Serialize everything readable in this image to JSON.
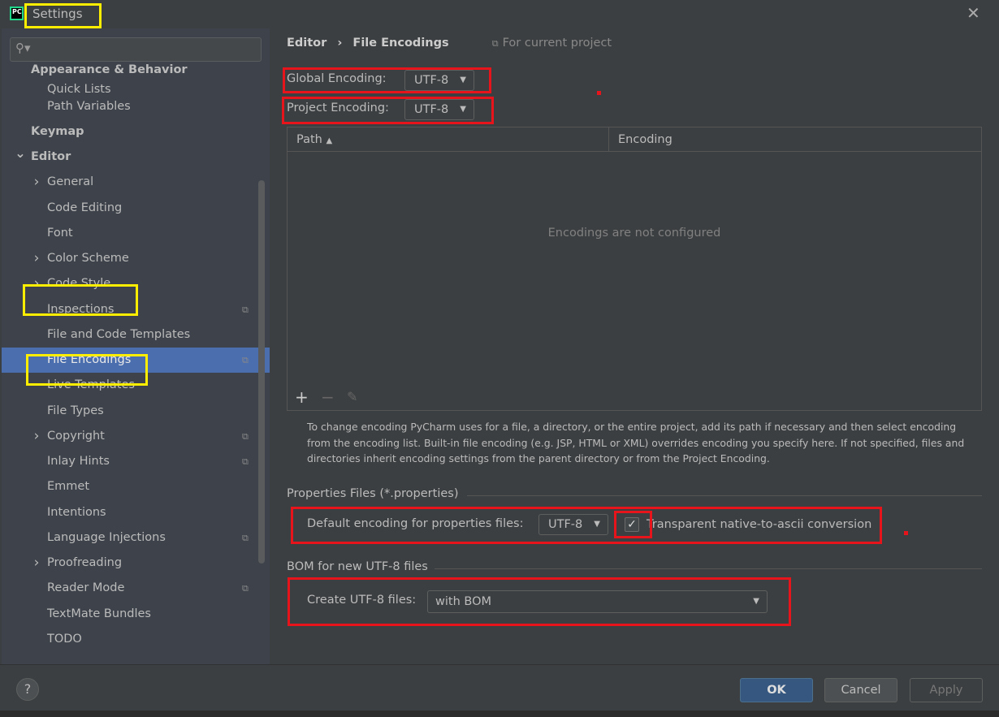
{
  "window": {
    "title": "Settings",
    "app_icon": "pycharm-icon"
  },
  "search": {
    "placeholder": ""
  },
  "sidebar": {
    "items": [
      {
        "label": "Appearance & Behavior",
        "bold": true
      },
      {
        "label": "Quick Lists"
      },
      {
        "label": "Path Variables"
      },
      {
        "label": "Keymap",
        "bold": true
      },
      {
        "label": "Editor",
        "bold": true,
        "expanded": true
      },
      {
        "label": "General",
        "chevron": true
      },
      {
        "label": "Code Editing"
      },
      {
        "label": "Font"
      },
      {
        "label": "Color Scheme",
        "chevron": true
      },
      {
        "label": "Code Style",
        "chevron": true
      },
      {
        "label": "Inspections",
        "project": true
      },
      {
        "label": "File and Code Templates"
      },
      {
        "label": "File Encodings",
        "project": true,
        "selected": true
      },
      {
        "label": "Live Templates"
      },
      {
        "label": "File Types"
      },
      {
        "label": "Copyright",
        "chevron": true,
        "project": true
      },
      {
        "label": "Inlay Hints",
        "project": true
      },
      {
        "label": "Emmet"
      },
      {
        "label": "Intentions"
      },
      {
        "label": "Language Injections",
        "project": true
      },
      {
        "label": "Proofreading",
        "chevron": true
      },
      {
        "label": "Reader Mode",
        "project": true
      },
      {
        "label": "TextMate Bundles"
      },
      {
        "label": "TODO"
      }
    ]
  },
  "breadcrumb": {
    "parent": "Editor",
    "separator": "›",
    "current": "File Encodings",
    "scope": "For current project"
  },
  "global_encoding": {
    "label": "Global Encoding:",
    "value": "UTF-8"
  },
  "project_encoding": {
    "label": "Project Encoding:",
    "value": "UTF-8"
  },
  "table": {
    "columns": [
      "Path",
      "Encoding"
    ],
    "empty_text": "Encodings are not configured"
  },
  "help_text": "To change encoding PyCharm uses for a file, a directory, or the entire project, add its path if necessary and then select encoding from the encoding list. Built-in file encoding (e.g. JSP, HTML or XML) overrides encoding you specify here. If not specified, files and directories inherit encoding settings from the parent directory or from the Project Encoding.",
  "properties": {
    "section": "Properties Files (*.properties)",
    "label": "Default encoding for properties files:",
    "value": "UTF-8",
    "checkbox_label": "Transparent native-to-ascii conversion",
    "checked": true
  },
  "bom": {
    "section": "BOM for new UTF-8 files",
    "label": "Create UTF-8 files:",
    "value": "with BOM"
  },
  "footer": {
    "ok": "OK",
    "cancel": "Cancel",
    "apply": "Apply",
    "help": "?"
  },
  "colors": {
    "accent": "#4b6eaf",
    "ok_button": "#365880",
    "annotation_red": "#e8141c",
    "annotation_yellow": "#ffee00"
  }
}
